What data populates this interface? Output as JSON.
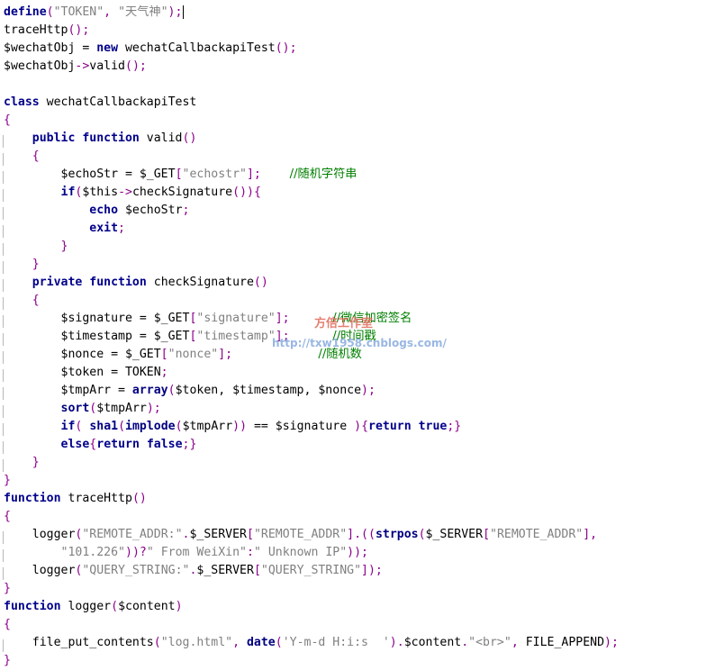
{
  "lines": [
    {
      "bar": false,
      "caret": true,
      "t": [
        [
          "kw",
          "define"
        ],
        [
          "pun",
          "("
        ],
        [
          "str",
          "\"TOKEN\""
        ],
        [
          "pun",
          ", "
        ],
        [
          "str",
          "\"天气神\""
        ],
        [
          "pun",
          ");"
        ]
      ]
    },
    {
      "bar": false,
      "t": [
        [
          "var",
          "traceHttp"
        ],
        [
          "pun",
          "();"
        ]
      ]
    },
    {
      "bar": false,
      "t": [
        [
          "var",
          "$wechatObj = "
        ],
        [
          "kw",
          "new"
        ],
        [
          "var",
          " wechatCallbackapiTest"
        ],
        [
          "pun",
          "();"
        ]
      ]
    },
    {
      "bar": false,
      "t": [
        [
          "var",
          "$wechatObj"
        ],
        [
          "pun",
          "->"
        ],
        [
          "var",
          "valid"
        ],
        [
          "pun",
          "();"
        ]
      ]
    },
    {
      "bar": false,
      "t": []
    },
    {
      "bar": false,
      "t": [
        [
          "kw",
          "class"
        ],
        [
          "var",
          " wechatCallbackapiTest"
        ]
      ]
    },
    {
      "bar": false,
      "t": [
        [
          "pun",
          "{"
        ]
      ]
    },
    {
      "bar": true,
      "t": [
        [
          "var",
          "    "
        ],
        [
          "kw",
          "public function"
        ],
        [
          "var",
          " valid"
        ],
        [
          "pun",
          "()"
        ]
      ]
    },
    {
      "bar": true,
      "t": [
        [
          "var",
          "    "
        ],
        [
          "pun",
          "{"
        ]
      ]
    },
    {
      "bar": true,
      "t": [
        [
          "var",
          "        $echoStr = $_GET"
        ],
        [
          "pun",
          "["
        ],
        [
          "str",
          "\"echostr\""
        ],
        [
          "pun",
          "];"
        ],
        [
          "var",
          "    "
        ],
        [
          "cmt",
          "//随机字符串"
        ]
      ]
    },
    {
      "bar": true,
      "t": [
        [
          "var",
          "        "
        ],
        [
          "kw",
          "if"
        ],
        [
          "pun",
          "("
        ],
        [
          "var",
          "$this"
        ],
        [
          "pun",
          "->"
        ],
        [
          "var",
          "checkSignature"
        ],
        [
          "pun",
          "()){"
        ]
      ]
    },
    {
      "bar": true,
      "t": [
        [
          "var",
          "            "
        ],
        [
          "kw",
          "echo"
        ],
        [
          "var",
          " $echoStr"
        ],
        [
          "pun",
          ";"
        ]
      ]
    },
    {
      "bar": true,
      "t": [
        [
          "var",
          "            "
        ],
        [
          "kw",
          "exit"
        ],
        [
          "pun",
          ";"
        ]
      ]
    },
    {
      "bar": true,
      "t": [
        [
          "var",
          "        "
        ],
        [
          "pun",
          "}"
        ]
      ]
    },
    {
      "bar": true,
      "t": [
        [
          "var",
          "    "
        ],
        [
          "pun",
          "}"
        ]
      ]
    },
    {
      "bar": true,
      "t": [
        [
          "var",
          "    "
        ],
        [
          "kw",
          "private function"
        ],
        [
          "var",
          " checkSignature"
        ],
        [
          "pun",
          "()"
        ]
      ]
    },
    {
      "bar": true,
      "t": [
        [
          "var",
          "    "
        ],
        [
          "pun",
          "{"
        ]
      ]
    },
    {
      "bar": true,
      "t": [
        [
          "var",
          "        $signature = $_GET"
        ],
        [
          "pun",
          "["
        ],
        [
          "str",
          "\"signature\""
        ],
        [
          "pun",
          "];"
        ],
        [
          "var",
          "      "
        ],
        [
          "cmt",
          "//微信加密签名"
        ]
      ]
    },
    {
      "bar": true,
      "t": [
        [
          "var",
          "        $timestamp = $_GET"
        ],
        [
          "pun",
          "["
        ],
        [
          "str",
          "\"timestamp\""
        ],
        [
          "pun",
          "];"
        ],
        [
          "var",
          "      "
        ],
        [
          "cmt",
          "//时间戳"
        ]
      ]
    },
    {
      "bar": true,
      "t": [
        [
          "var",
          "        $nonce = $_GET"
        ],
        [
          "pun",
          "["
        ],
        [
          "str",
          "\"nonce\""
        ],
        [
          "pun",
          "];"
        ],
        [
          "var",
          "            "
        ],
        [
          "cmt",
          "//随机数"
        ]
      ]
    },
    {
      "bar": true,
      "t": [
        [
          "var",
          "        $token = TOKEN"
        ],
        [
          "pun",
          ";"
        ]
      ]
    },
    {
      "bar": true,
      "t": [
        [
          "var",
          "        $tmpArr = "
        ],
        [
          "fn",
          "array"
        ],
        [
          "pun",
          "("
        ],
        [
          "var",
          "$token, $timestamp, $nonce"
        ],
        [
          "pun",
          ");"
        ]
      ]
    },
    {
      "bar": true,
      "t": [
        [
          "var",
          "        "
        ],
        [
          "fn",
          "sort"
        ],
        [
          "pun",
          "("
        ],
        [
          "var",
          "$tmpArr"
        ],
        [
          "pun",
          ");"
        ]
      ]
    },
    {
      "bar": true,
      "t": [
        [
          "var",
          "        "
        ],
        [
          "kw",
          "if"
        ],
        [
          "pun",
          "( "
        ],
        [
          "fn",
          "sha1"
        ],
        [
          "pun",
          "("
        ],
        [
          "fn",
          "implode"
        ],
        [
          "pun",
          "("
        ],
        [
          "var",
          "$tmpArr"
        ],
        [
          "pun",
          "))"
        ],
        [
          "var",
          " == $signature "
        ],
        [
          "pun",
          "){"
        ],
        [
          "kw",
          "return true"
        ],
        [
          "pun",
          ";}"
        ]
      ]
    },
    {
      "bar": true,
      "t": [
        [
          "var",
          "        "
        ],
        [
          "kw",
          "else"
        ],
        [
          "pun",
          "{"
        ],
        [
          "kw",
          "return false"
        ],
        [
          "pun",
          ";}"
        ]
      ]
    },
    {
      "bar": true,
      "t": [
        [
          "var",
          "    "
        ],
        [
          "pun",
          "}"
        ]
      ]
    },
    {
      "bar": false,
      "t": [
        [
          "pun",
          "}"
        ]
      ]
    },
    {
      "bar": false,
      "t": [
        [
          "kw",
          "function"
        ],
        [
          "var",
          " traceHttp"
        ],
        [
          "pun",
          "()"
        ]
      ]
    },
    {
      "bar": false,
      "t": [
        [
          "pun",
          "{"
        ]
      ]
    },
    {
      "bar": true,
      "t": [
        [
          "var",
          "    logger"
        ],
        [
          "pun",
          "("
        ],
        [
          "str",
          "\"REMOTE_ADDR:\""
        ],
        [
          "pun",
          "."
        ],
        [
          "var",
          "$_SERVER"
        ],
        [
          "pun",
          "["
        ],
        [
          "str",
          "\"REMOTE_ADDR\""
        ],
        [
          "pun",
          "].(("
        ],
        [
          "fn",
          "strpos"
        ],
        [
          "pun",
          "("
        ],
        [
          "var",
          "$_SERVER"
        ],
        [
          "pun",
          "["
        ],
        [
          "str",
          "\"REMOTE_ADDR\""
        ],
        [
          "pun",
          "],"
        ]
      ]
    },
    {
      "bar": true,
      "t": [
        [
          "var",
          "        "
        ],
        [
          "str",
          "\"101.226\""
        ],
        [
          "pun",
          "))?"
        ],
        [
          "str",
          "\" From WeiXin\""
        ],
        [
          "pun",
          ":"
        ],
        [
          "str",
          "\" Unknown IP\""
        ],
        [
          "pun",
          "));"
        ]
      ]
    },
    {
      "bar": true,
      "t": [
        [
          "var",
          "    logger"
        ],
        [
          "pun",
          "("
        ],
        [
          "str",
          "\"QUERY_STRING:\""
        ],
        [
          "pun",
          "."
        ],
        [
          "var",
          "$_SERVER"
        ],
        [
          "pun",
          "["
        ],
        [
          "str",
          "\"QUERY_STRING\""
        ],
        [
          "pun",
          "]);"
        ]
      ]
    },
    {
      "bar": false,
      "t": [
        [
          "pun",
          "}"
        ]
      ]
    },
    {
      "bar": false,
      "t": [
        [
          "kw",
          "function"
        ],
        [
          "var",
          " logger"
        ],
        [
          "pun",
          "("
        ],
        [
          "var",
          "$content"
        ],
        [
          "pun",
          ")"
        ]
      ]
    },
    {
      "bar": false,
      "t": [
        [
          "pun",
          "{"
        ]
      ]
    },
    {
      "bar": true,
      "t": [
        [
          "var",
          "    file_put_contents"
        ],
        [
          "pun",
          "("
        ],
        [
          "str",
          "\"log.html\""
        ],
        [
          "pun",
          ", "
        ],
        [
          "fn",
          "date"
        ],
        [
          "pun",
          "("
        ],
        [
          "str",
          "'Y-m-d H:i:s  '"
        ],
        [
          "pun",
          ")."
        ],
        [
          "var",
          "$content"
        ],
        [
          "pun",
          "."
        ],
        [
          "str",
          "\"<br>\""
        ],
        [
          "pun",
          ", "
        ],
        [
          "var",
          "FILE_APPEND"
        ],
        [
          "pun",
          ");"
        ]
      ]
    },
    {
      "bar": false,
      "t": [
        [
          "pun",
          "}"
        ]
      ]
    }
  ],
  "watermark": {
    "name": "方倍工作室",
    "url": "http://txw1958.cnblogs.com/"
  }
}
